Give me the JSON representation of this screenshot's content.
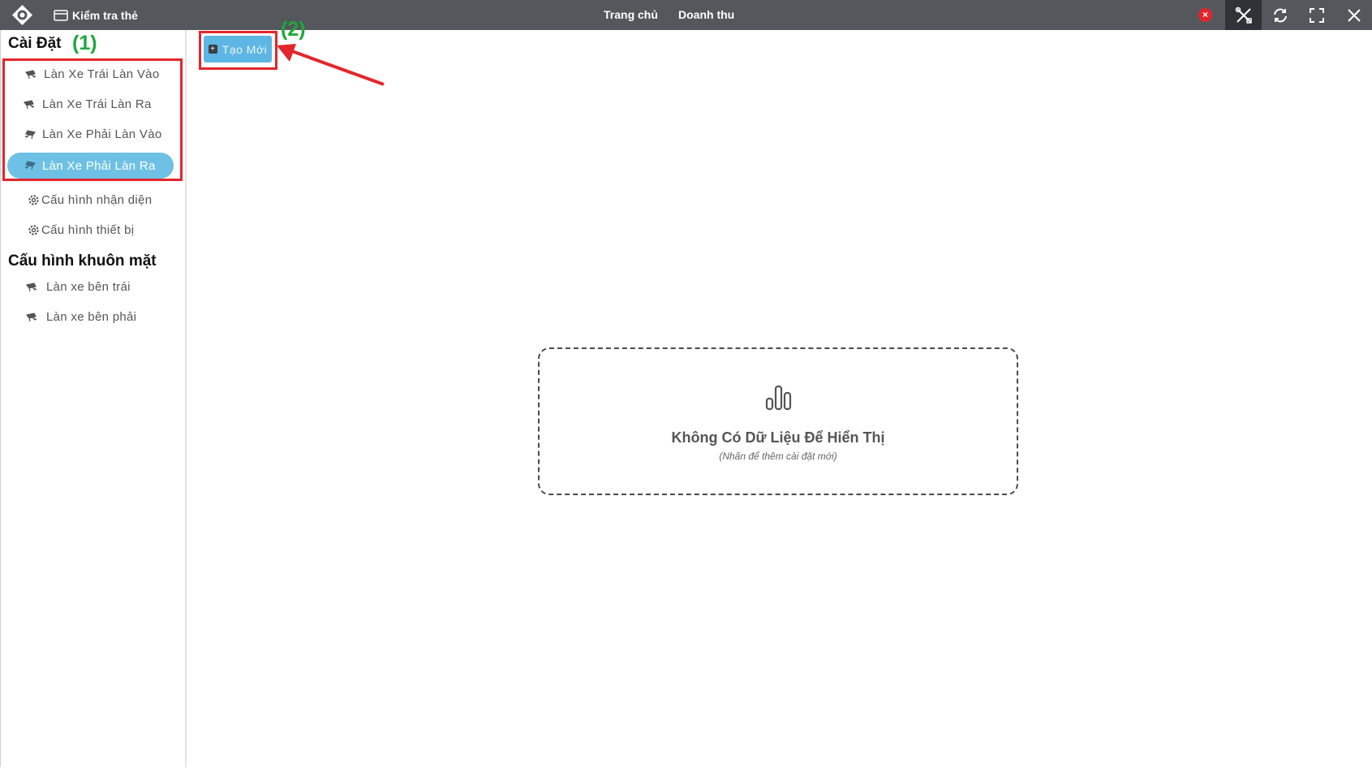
{
  "titlebar": {
    "card_check_label": "Kiểm tra thẻ",
    "nav": {
      "home": "Trang chủ",
      "revenue": "Doanh thu"
    },
    "close_badge": "×"
  },
  "sidebar": {
    "settings_title": "Cài Đặt",
    "settings_annotation": "(1)",
    "lanes": [
      {
        "label": "Làn Xe Trái Làn Vào"
      },
      {
        "label": "Làn Xe Trái Làn Ra"
      },
      {
        "label": "Làn Xe Phải Làn Vào"
      },
      {
        "label": "Làn Xe Phải Làn Ra",
        "active": true
      }
    ],
    "config": [
      {
        "label": "Cấu hình nhận diện"
      },
      {
        "label": "Cấu hình thiết bị"
      }
    ],
    "face_title": "Cấu hình khuôn mặt",
    "face_items": [
      {
        "label": "Làn xe bên trái"
      },
      {
        "label": "Làn xe bên phải"
      }
    ]
  },
  "main": {
    "create_button": {
      "label": "Tạo Mới",
      "icon": "plus-square-icon"
    },
    "create_annotation": "(2)",
    "empty_state": {
      "icon": "bar-chart-icon",
      "title": "Không Có Dữ Liệu Để Hiển Thị",
      "hint": "(Nhấn để thêm cài đặt mới)"
    }
  },
  "colors": {
    "titlebar": "#54585d",
    "active_item": "#6ec1e4",
    "create_button": "#5db6e3",
    "annotation_red": "#e3262c",
    "annotation_green": "#1ea839"
  }
}
